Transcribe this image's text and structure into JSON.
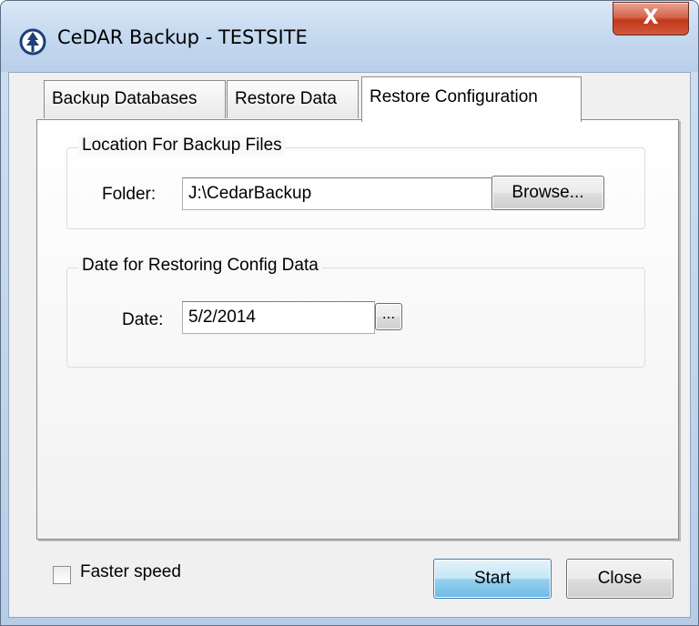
{
  "window": {
    "title": "CeDAR Backup - TESTSITE",
    "close_glyph": "X"
  },
  "tabs": [
    {
      "label": "Backup Databases",
      "active": false
    },
    {
      "label": "Restore Data",
      "active": false
    },
    {
      "label": "Restore Configuration",
      "active": true
    }
  ],
  "location_group": {
    "legend": "Location For Backup Files",
    "folder_label": "Folder:",
    "folder_value": "J:\\CedarBackup",
    "browse_label": "Browse..."
  },
  "date_group": {
    "legend": "Date for Restoring Config Data",
    "date_label": "Date:",
    "date_value": "5/2/2014",
    "picker_label": "..."
  },
  "footer": {
    "faster_speed_label": "Faster speed",
    "faster_speed_checked": false,
    "start_label": "Start",
    "close_label": "Close"
  },
  "icons": {
    "app": "cedar-tree-icon"
  }
}
